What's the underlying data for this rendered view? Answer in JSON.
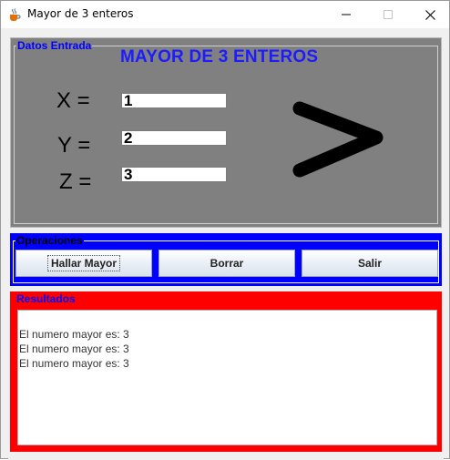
{
  "window": {
    "title": "Mayor de 3 enteros"
  },
  "panels": {
    "datos": {
      "legend": "Datos Entrada"
    },
    "operaciones": {
      "legend": "Operaciones"
    },
    "resultados": {
      "legend": "Resultados"
    }
  },
  "header": {
    "title": "MAYOR DE 3 ENTEROS"
  },
  "inputs": {
    "x": {
      "label": "X =",
      "value": "1"
    },
    "y": {
      "label": "Y =",
      "value": "2"
    },
    "z": {
      "label": "Z =",
      "value": "3"
    }
  },
  "buttons": {
    "hallar": "Hallar Mayor",
    "borrar": "Borrar",
    "salir": "Salir"
  },
  "results": {
    "lines": [
      "El numero mayor es: 3",
      "El numero mayor es: 3",
      "El numero mayor es: 3"
    ]
  },
  "colors": {
    "datos_bg": "#808080",
    "operaciones_bg": "#0000ff",
    "resultados_bg": "#ff0000",
    "title_color": "#1c1cff"
  },
  "icons": {
    "app": "java-coffee-icon",
    "minimize": "minimize-icon",
    "maximize": "maximize-icon",
    "close": "close-icon",
    "decoration": "greater-than-icon"
  }
}
